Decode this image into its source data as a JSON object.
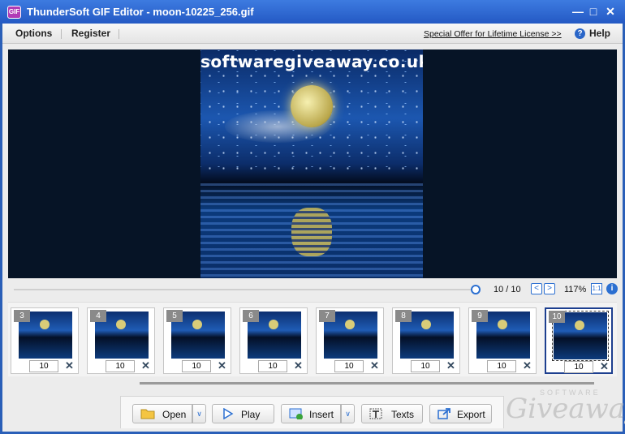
{
  "window": {
    "title": "ThunderSoft GIF Editor - moon-10225_256.gif",
    "app_icon_label": "GIF",
    "controls": {
      "minimize": "—",
      "maximize": "□",
      "close": "✕"
    }
  },
  "menu": {
    "items": [
      "Options",
      "Register"
    ],
    "offer_link": "Special Offer for Lifetime License >>",
    "help_label": "Help",
    "help_icon": "?"
  },
  "preview": {
    "watermark_text": "softwaregiveaway.co.uk"
  },
  "playback": {
    "frame_counter": "10 / 10",
    "zoom": "117%",
    "ratio_label": "1:1",
    "info_icon": "i",
    "prev_icon": "<",
    "next_icon": ">",
    "position_fraction": 1.0
  },
  "frames": [
    {
      "number": "3",
      "delay": "10"
    },
    {
      "number": "4",
      "delay": "10"
    },
    {
      "number": "5",
      "delay": "10"
    },
    {
      "number": "6",
      "delay": "10"
    },
    {
      "number": "7",
      "delay": "10"
    },
    {
      "number": "8",
      "delay": "10"
    },
    {
      "number": "9",
      "delay": "10"
    },
    {
      "number": "10",
      "delay": "10",
      "selected": true
    }
  ],
  "frame_delete_icon": "✕",
  "toolbar": {
    "open": "Open",
    "play": "Play",
    "insert": "Insert",
    "texts": "Texts",
    "export": "Export",
    "dropdown_icon": "∨"
  },
  "brand": {
    "small": "SOFTWARE",
    "large": "Giveaway"
  },
  "colors": {
    "titlebar": "#2a5fb8",
    "accent": "#2b6fd1",
    "preview_bg": "#061426"
  }
}
